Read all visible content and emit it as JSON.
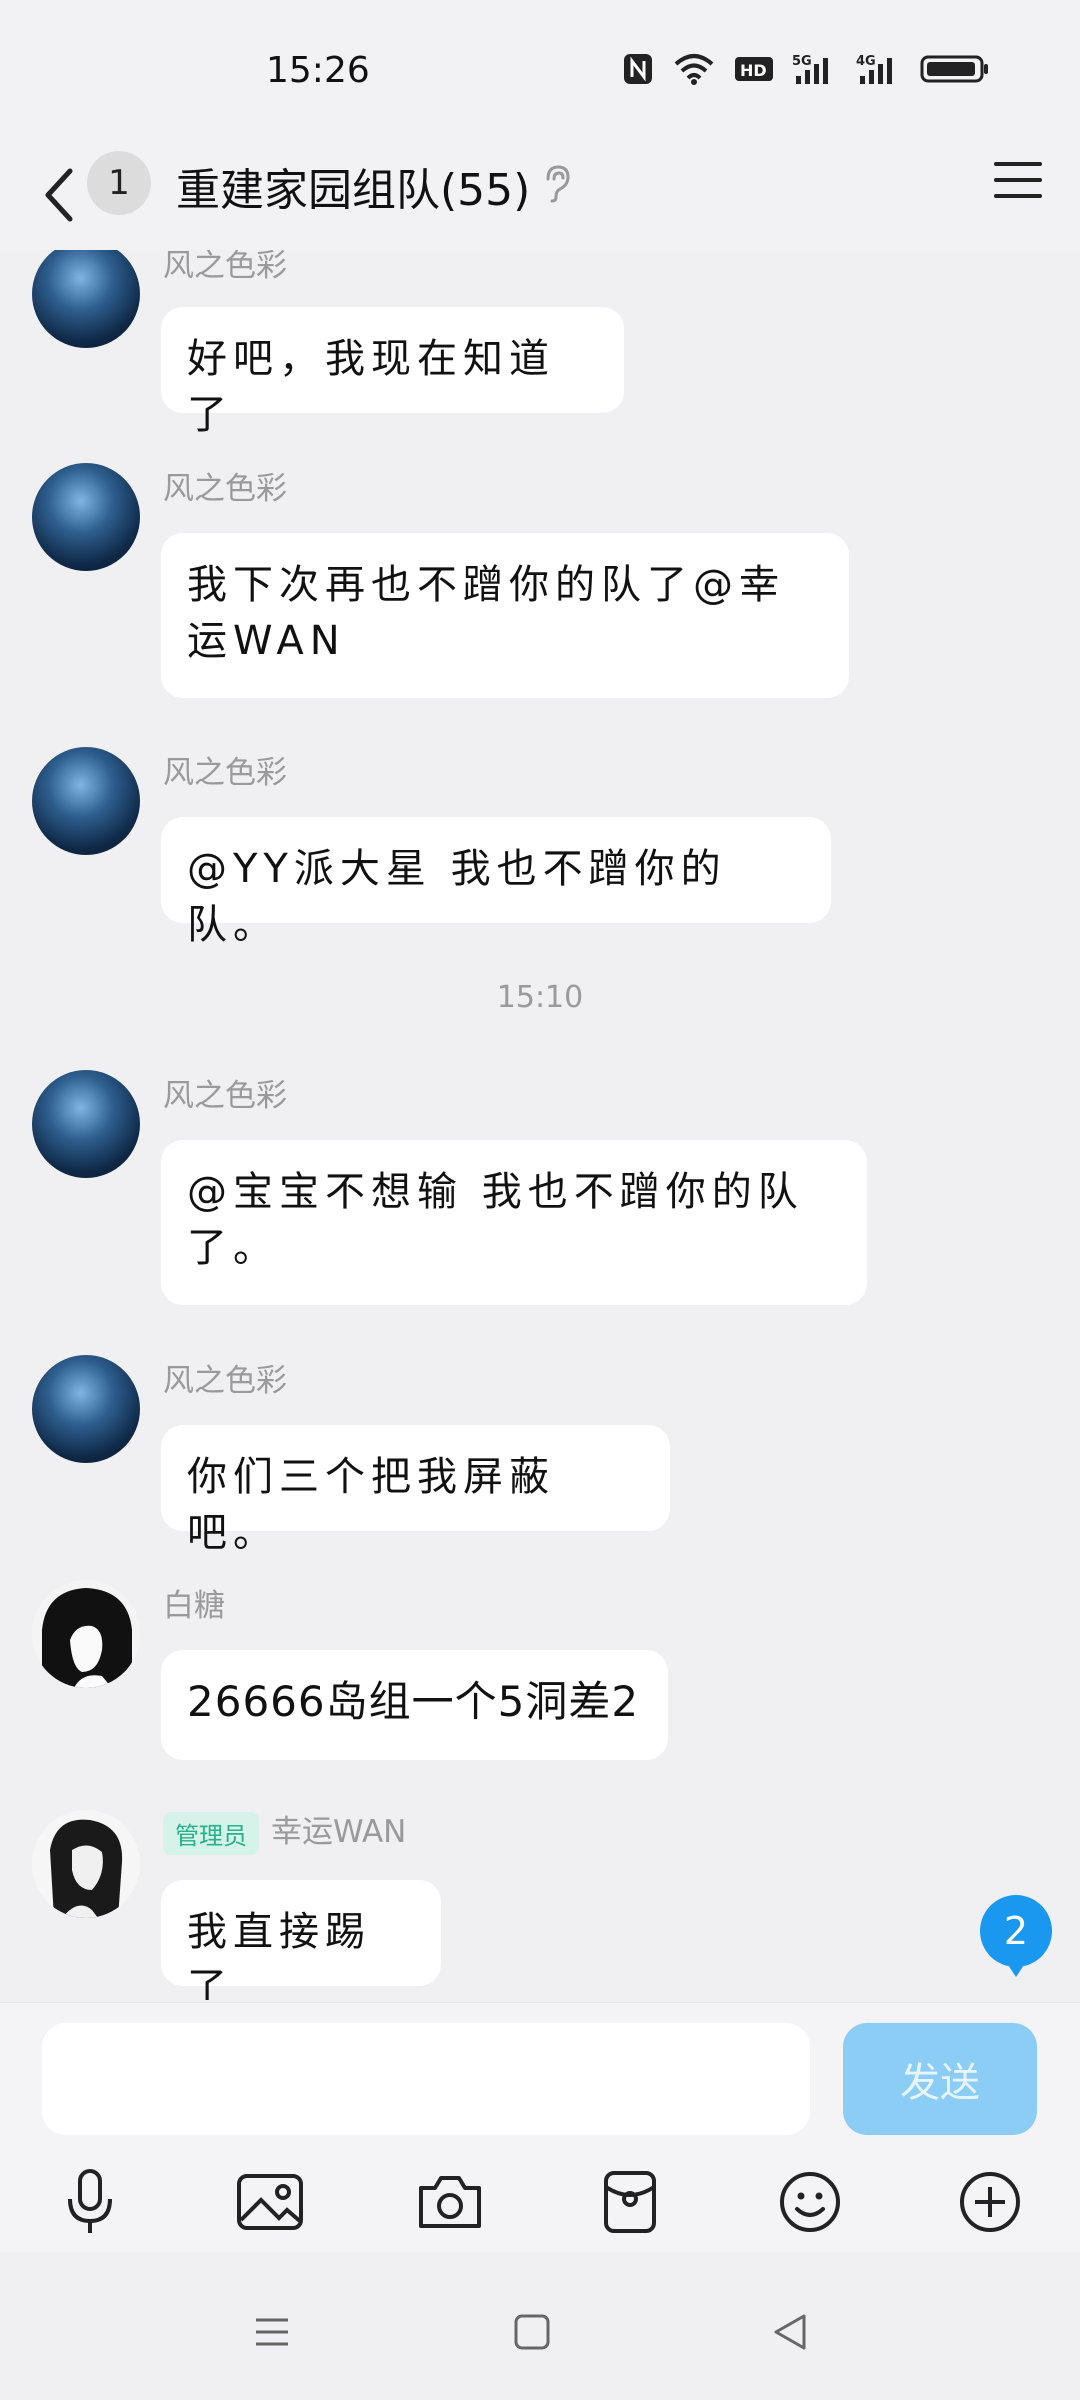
{
  "status_bar": {
    "time": "15:26"
  },
  "header": {
    "unread_count": "1",
    "title": "重建家园组队(55)"
  },
  "messages": [
    {
      "sender": "风之色彩",
      "text": "好吧，我现在知道了"
    },
    {
      "sender": "风之色彩",
      "text": "我下次再也不蹭你的队了@幸运WAN"
    },
    {
      "sender": "风之色彩",
      "text": "@YY派大星 我也不蹭你的队。"
    },
    {
      "timestamp": "15:10"
    },
    {
      "sender": "风之色彩",
      "text": "@宝宝不想输 我也不蹭你的队了。"
    },
    {
      "sender": "风之色彩",
      "text": "你们三个把我屏蔽吧。"
    },
    {
      "sender": "白糖",
      "text": "26666岛组一个5洞差2"
    },
    {
      "role": "管理员",
      "sender": "幸运WAN",
      "text": "我直接踢了"
    }
  ],
  "new_message_count": "2",
  "input": {
    "placeholder": "",
    "value": ""
  },
  "send_label": "发送",
  "toolbar_icons": [
    "microphone-icon",
    "image-icon",
    "camera-icon",
    "red-packet-icon",
    "emoji-icon",
    "plus-icon"
  ],
  "colors": {
    "accent": "#1a98f0",
    "send_disabled": "#8ccdf5",
    "admin_badge_bg": "#d6f3ea",
    "admin_badge_text": "#28b08a"
  }
}
